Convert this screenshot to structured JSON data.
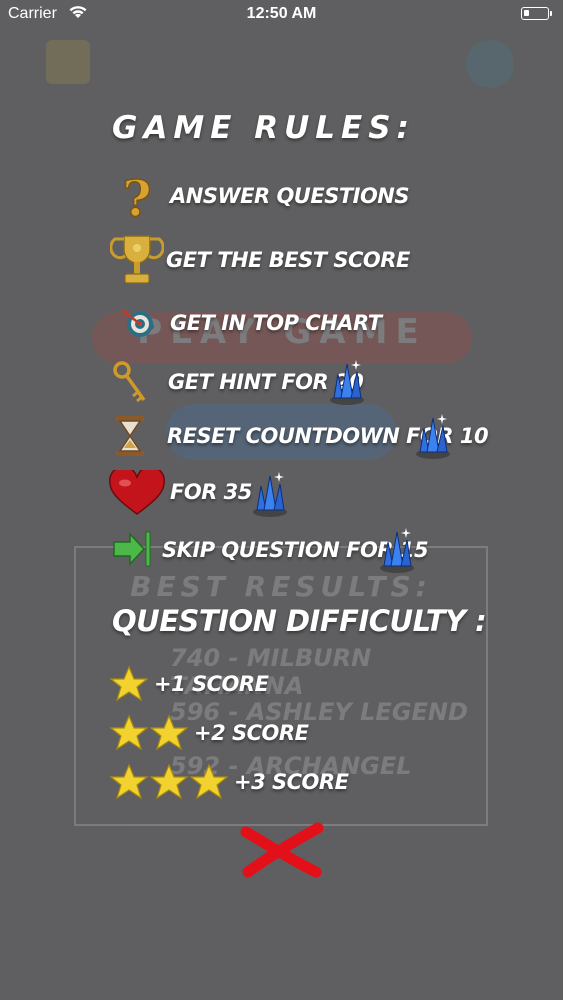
{
  "status_bar": {
    "carrier": "Carrier",
    "time": "12:50 AM"
  },
  "background": {
    "play_label": "PLAY GAME",
    "results_title": "BEST RESULTS:",
    "results": [
      "740 - MILBURN TATIANNA",
      "596 - ASHLEY LEGEND",
      "592 - ARCHANGEL"
    ]
  },
  "rules": {
    "title": "GAME RULES:",
    "items": [
      {
        "icon": "question-mark-icon",
        "label": "ANSWER QUESTIONS"
      },
      {
        "icon": "trophy-icon",
        "label": "GET THE BEST SCORE"
      },
      {
        "icon": "target-icon",
        "label": "GET IN TOP CHART"
      },
      {
        "icon": "key-icon",
        "label": "GET HINT FOR 20"
      },
      {
        "icon": "hourglass-icon",
        "label": "RESET COUNTDOWN FOR 10"
      },
      {
        "icon": "heart-icon",
        "label": "FOR 35"
      },
      {
        "icon": "skip-arrow-icon",
        "label": "SKIP QUESTION FOR 15"
      }
    ],
    "currency_icon": "blue-crystal-icon"
  },
  "difficulty": {
    "title": "QUESTION DIFFICULTY :",
    "levels": [
      {
        "stars": 1,
        "label": "+1 SCORE"
      },
      {
        "stars": 2,
        "label": "+2 SCORE"
      },
      {
        "stars": 3,
        "label": "+3 SCORE"
      }
    ]
  },
  "close_icon": "red-x-close-icon",
  "colors": {
    "background": "#5f5f61",
    "star": "#f2d22e",
    "crystal": "#2f6fe0",
    "close": "#e3101a"
  }
}
